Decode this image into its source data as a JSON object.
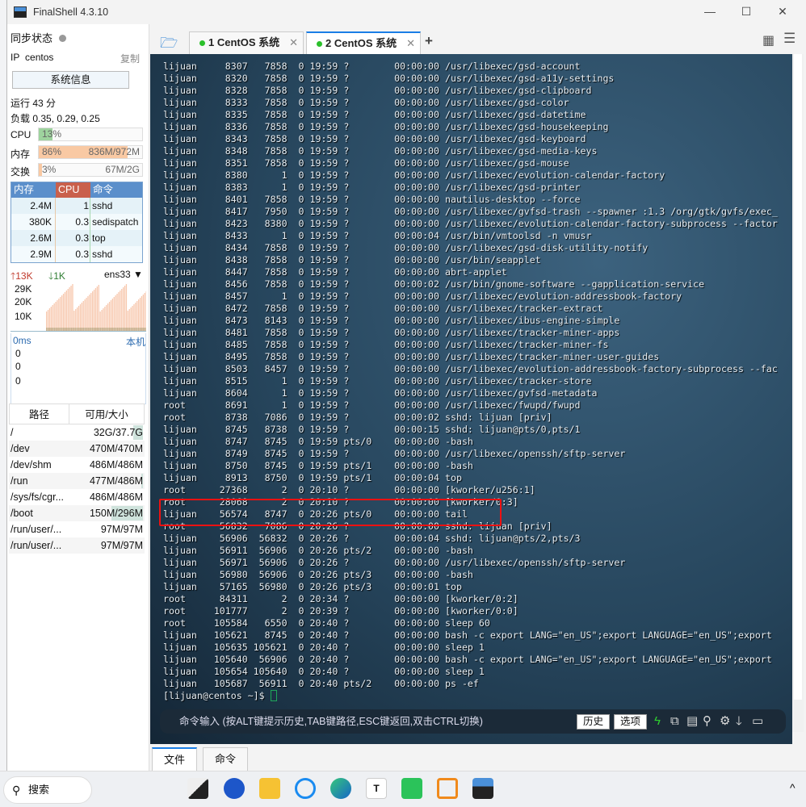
{
  "window": {
    "title": "FinalShell 4.3.10",
    "minimize": "—",
    "maximize": "☐",
    "close": "✕"
  },
  "left": {
    "sync_label": "同步状态",
    "ip_label": "IP",
    "ip_value": "centos",
    "copy": "复制",
    "sysinfo_button": "系统信息",
    "uptime": "运行 43 分",
    "load": "负载 0.35, 0.29, 0.25",
    "cpu": {
      "label": "CPU",
      "text": "13%",
      "percent": 13
    },
    "mem": {
      "label": "内存",
      "text": "86%",
      "detail": "836M/972M",
      "percent": 86
    },
    "swap": {
      "label": "交换",
      "text": "3%",
      "detail": "67M/2G",
      "percent": 3
    },
    "proc_headers": [
      "内存",
      "CPU",
      "命令"
    ],
    "procs": [
      [
        "2.4M",
        "1",
        "sshd"
      ],
      [
        "380K",
        "0.3",
        "sedispatch"
      ],
      [
        "2.6M",
        "0.3",
        "top"
      ],
      [
        "2.9M",
        "0.3",
        "sshd"
      ]
    ],
    "net": {
      "up": "13K",
      "down": "1K",
      "iface": "ens33",
      "ticks": [
        "29K",
        "20K",
        "10K"
      ]
    },
    "latency": {
      "ms": "0ms",
      "host": "本机",
      "values": [
        "0",
        "0",
        "0"
      ]
    },
    "disk_headers": [
      "路径",
      "可用/大小"
    ],
    "disks": [
      {
        "path": "/",
        "size": "32G/37.7G",
        "used": 15
      },
      {
        "path": "/dev",
        "size": "470M/470M",
        "used": 0
      },
      {
        "path": "/dev/shm",
        "size": "486M/486M",
        "used": 0
      },
      {
        "path": "/run",
        "size": "477M/486M",
        "used": 2
      },
      {
        "path": "/sys/fs/cgr...",
        "size": "486M/486M",
        "used": 0
      },
      {
        "path": "/boot",
        "size": "150M/296M",
        "used": 49
      },
      {
        "path": "/run/user/...",
        "size": "97M/97M",
        "used": 0
      },
      {
        "path": "/run/user/...",
        "size": "97M/97M",
        "used": 0
      }
    ]
  },
  "tabs": [
    {
      "label": "1 CentOS 系统",
      "active": false
    },
    {
      "label": "2 CentOS 系统",
      "active": true
    }
  ],
  "add_tab": "+",
  "colors": {
    "accent": "#1a7ee6",
    "cpu": "#9ed39e",
    "mem": "#f9c9a3",
    "highlight": "#e11111"
  },
  "terminal": {
    "rows": [
      [
        "lijuan",
        "8307",
        "7858",
        "0",
        "19:59",
        "?",
        "00:00:00",
        "/usr/libexec/gsd-account"
      ],
      [
        "lijuan",
        "8320",
        "7858",
        "0",
        "19:59",
        "?",
        "00:00:00",
        "/usr/libexec/gsd-a11y-settings"
      ],
      [
        "lijuan",
        "8328",
        "7858",
        "0",
        "19:59",
        "?",
        "00:00:00",
        "/usr/libexec/gsd-clipboard"
      ],
      [
        "lijuan",
        "8333",
        "7858",
        "0",
        "19:59",
        "?",
        "00:00:00",
        "/usr/libexec/gsd-color"
      ],
      [
        "lijuan",
        "8335",
        "7858",
        "0",
        "19:59",
        "?",
        "00:00:00",
        "/usr/libexec/gsd-datetime"
      ],
      [
        "lijuan",
        "8336",
        "7858",
        "0",
        "19:59",
        "?",
        "00:00:00",
        "/usr/libexec/gsd-housekeeping"
      ],
      [
        "lijuan",
        "8343",
        "7858",
        "0",
        "19:59",
        "?",
        "00:00:00",
        "/usr/libexec/gsd-keyboard"
      ],
      [
        "lijuan",
        "8348",
        "7858",
        "0",
        "19:59",
        "?",
        "00:00:00",
        "/usr/libexec/gsd-media-keys"
      ],
      [
        "lijuan",
        "8351",
        "7858",
        "0",
        "19:59",
        "?",
        "00:00:00",
        "/usr/libexec/gsd-mouse"
      ],
      [
        "lijuan",
        "8380",
        "1",
        "0",
        "19:59",
        "?",
        "00:00:00",
        "/usr/libexec/evolution-calendar-factory"
      ],
      [
        "lijuan",
        "8383",
        "1",
        "0",
        "19:59",
        "?",
        "00:00:00",
        "/usr/libexec/gsd-printer"
      ],
      [
        "lijuan",
        "8401",
        "7858",
        "0",
        "19:59",
        "?",
        "00:00:00",
        "nautilus-desktop --force"
      ],
      [
        "lijuan",
        "8417",
        "7950",
        "0",
        "19:59",
        "?",
        "00:00:00",
        "/usr/libexec/gvfsd-trash --spawner :1.3 /org/gtk/gvfs/exec_"
      ],
      [
        "lijuan",
        "8423",
        "8380",
        "0",
        "19:59",
        "?",
        "00:00:00",
        "/usr/libexec/evolution-calendar-factory-subprocess --factor"
      ],
      [
        "lijuan",
        "8433",
        "1",
        "0",
        "19:59",
        "?",
        "00:00:04",
        "/usr/bin/vmtoolsd -n vmusr"
      ],
      [
        "lijuan",
        "8434",
        "7858",
        "0",
        "19:59",
        "?",
        "00:00:00",
        "/usr/libexec/gsd-disk-utility-notify"
      ],
      [
        "lijuan",
        "8438",
        "7858",
        "0",
        "19:59",
        "?",
        "00:00:00",
        "/usr/bin/seapplet"
      ],
      [
        "lijuan",
        "8447",
        "7858",
        "0",
        "19:59",
        "?",
        "00:00:00",
        "abrt-applet"
      ],
      [
        "lijuan",
        "8456",
        "7858",
        "0",
        "19:59",
        "?",
        "00:00:02",
        "/usr/bin/gnome-software --gapplication-service"
      ],
      [
        "lijuan",
        "8457",
        "1",
        "0",
        "19:59",
        "?",
        "00:00:00",
        "/usr/libexec/evolution-addressbook-factory"
      ],
      [
        "lijuan",
        "8472",
        "7858",
        "0",
        "19:59",
        "?",
        "00:00:00",
        "/usr/libexec/tracker-extract"
      ],
      [
        "lijuan",
        "8473",
        "8143",
        "0",
        "19:59",
        "?",
        "00:00:00",
        "/usr/libexec/ibus-engine-simple"
      ],
      [
        "lijuan",
        "8481",
        "7858",
        "0",
        "19:59",
        "?",
        "00:00:00",
        "/usr/libexec/tracker-miner-apps"
      ],
      [
        "lijuan",
        "8485",
        "7858",
        "0",
        "19:59",
        "?",
        "00:00:00",
        "/usr/libexec/tracker-miner-fs"
      ],
      [
        "lijuan",
        "8495",
        "7858",
        "0",
        "19:59",
        "?",
        "00:00:00",
        "/usr/libexec/tracker-miner-user-guides"
      ],
      [
        "lijuan",
        "8503",
        "8457",
        "0",
        "19:59",
        "?",
        "00:00:00",
        "/usr/libexec/evolution-addressbook-factory-subprocess --fac"
      ],
      [
        "lijuan",
        "8515",
        "1",
        "0",
        "19:59",
        "?",
        "00:00:00",
        "/usr/libexec/tracker-store"
      ],
      [
        "lijuan",
        "8604",
        "1",
        "0",
        "19:59",
        "?",
        "00:00:00",
        "/usr/libexec/gvfsd-metadata"
      ],
      [
        "root",
        "8691",
        "1",
        "0",
        "19:59",
        "?",
        "00:00:00",
        "/usr/libexec/fwupd/fwupd"
      ],
      [
        "root",
        "8738",
        "7086",
        "0",
        "19:59",
        "?",
        "00:00:02",
        "sshd: lijuan [priv]"
      ],
      [
        "lijuan",
        "8745",
        "8738",
        "0",
        "19:59",
        "?",
        "00:00:15",
        "sshd: lijuan@pts/0,pts/1"
      ],
      [
        "lijuan",
        "8747",
        "8745",
        "0",
        "19:59",
        "pts/0",
        "00:00:00",
        "-bash"
      ],
      [
        "lijuan",
        "8749",
        "8745",
        "0",
        "19:59",
        "?",
        "00:00:00",
        "/usr/libexec/openssh/sftp-server"
      ],
      [
        "lijuan",
        "8750",
        "8745",
        "0",
        "19:59",
        "pts/1",
        "00:00:00",
        "-bash"
      ],
      [
        "lijuan",
        "8913",
        "8750",
        "0",
        "19:59",
        "pts/1",
        "00:00:04",
        "top"
      ],
      [
        "root",
        "27368",
        "2",
        "0",
        "20:10",
        "?",
        "00:00:00",
        "[kworker/u256:1]"
      ],
      [
        "root",
        "28068",
        "2",
        "0",
        "20:10",
        "?",
        "00:00:00",
        "[kworker/0:3]"
      ],
      [
        "lijuan",
        "56574",
        "8747",
        "0",
        "20:26",
        "pts/0",
        "00:00:00",
        "tail"
      ],
      [
        "root",
        "56832",
        "7086",
        "0",
        "20:26",
        "?",
        "00:00:00",
        "sshd: lijuan [priv]"
      ],
      [
        "lijuan",
        "56906",
        "56832",
        "0",
        "20:26",
        "?",
        "00:00:04",
        "sshd: lijuan@pts/2,pts/3"
      ],
      [
        "lijuan",
        "56911",
        "56906",
        "0",
        "20:26",
        "pts/2",
        "00:00:00",
        "-bash"
      ],
      [
        "lijuan",
        "56971",
        "56906",
        "0",
        "20:26",
        "?",
        "00:00:00",
        "/usr/libexec/openssh/sftp-server"
      ],
      [
        "lijuan",
        "56980",
        "56906",
        "0",
        "20:26",
        "pts/3",
        "00:00:00",
        "-bash"
      ],
      [
        "lijuan",
        "57165",
        "56980",
        "0",
        "20:26",
        "pts/3",
        "00:00:01",
        "top"
      ],
      [
        "root",
        "84311",
        "2",
        "0",
        "20:34",
        "?",
        "00:00:00",
        "[kworker/0:2]"
      ],
      [
        "root",
        "101777",
        "2",
        "0",
        "20:39",
        "?",
        "00:00:00",
        "[kworker/0:0]"
      ],
      [
        "root",
        "105584",
        "6550",
        "0",
        "20:40",
        "?",
        "00:00:00",
        "sleep 60"
      ],
      [
        "lijuan",
        "105621",
        "8745",
        "0",
        "20:40",
        "?",
        "00:00:00",
        "bash -c export LANG=\"en_US\";export LANGUAGE=\"en_US\";export"
      ],
      [
        "lijuan",
        "105635",
        "105621",
        "0",
        "20:40",
        "?",
        "00:00:00",
        "sleep 1"
      ],
      [
        "lijuan",
        "105640",
        "56906",
        "0",
        "20:40",
        "?",
        "00:00:00",
        "bash -c export LANG=\"en_US\";export LANGUAGE=\"en_US\";export"
      ],
      [
        "lijuan",
        "105654",
        "105640",
        "0",
        "20:40",
        "?",
        "00:00:00",
        "sleep 1"
      ],
      [
        "lijuan",
        "105687",
        "56911",
        "0",
        "20:40",
        "pts/2",
        "00:00:00",
        "ps -ef"
      ]
    ],
    "prompt": "[lijuan@centos ~]$ "
  },
  "cmdbar": {
    "hint": "命令输入 (按ALT键提示历史,TAB键路径,ESC键返回,双击CTRL切换)",
    "history": "历史",
    "options": "选项"
  },
  "bottom_tabs": [
    "文件",
    "命令"
  ],
  "taskbar": {
    "search": "搜索"
  }
}
